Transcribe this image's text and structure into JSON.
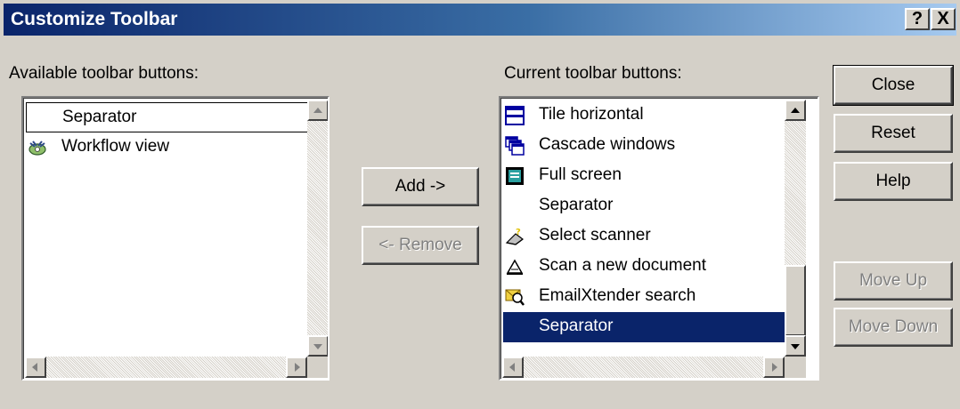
{
  "window": {
    "title": "Customize Toolbar",
    "help_glyph": "?",
    "close_glyph": "X",
    "title_gradient": [
      "#0a246a",
      "#a6caf0"
    ]
  },
  "available": {
    "label": "Available toolbar buttons:",
    "items": [
      {
        "label": "Separator",
        "icon": "none",
        "state": "focused"
      },
      {
        "label": "Workflow view",
        "icon": "workflow-icon",
        "state": "normal"
      }
    ]
  },
  "current": {
    "label": "Current toolbar buttons:",
    "items": [
      {
        "label": "Tile horizontal",
        "icon": "tile-horizontal-icon",
        "state": "normal"
      },
      {
        "label": "Cascade windows",
        "icon": "cascade-windows-icon",
        "state": "normal"
      },
      {
        "label": "Full screen",
        "icon": "full-screen-icon",
        "state": "normal"
      },
      {
        "label": "Separator",
        "icon": "none",
        "state": "normal"
      },
      {
        "label": "Select scanner",
        "icon": "select-scanner-icon",
        "state": "normal"
      },
      {
        "label": "Scan a new document",
        "icon": "scan-document-icon",
        "state": "normal"
      },
      {
        "label": "EmailXtender search",
        "icon": "emailxtender-search-icon",
        "state": "normal"
      },
      {
        "label": "Separator",
        "icon": "none",
        "state": "selected"
      }
    ]
  },
  "buttons": {
    "add": "Add ->",
    "remove": "<- Remove",
    "close": "Close",
    "reset": "Reset",
    "help": "Help",
    "move_up": "Move Up",
    "move_down": "Move Down"
  },
  "button_states": {
    "remove": "disabled",
    "move_up": "disabled",
    "move_down": "disabled"
  },
  "colors": {
    "face": "#d4d0c8",
    "selection": "#0a246a",
    "disabled_text": "#808080"
  }
}
